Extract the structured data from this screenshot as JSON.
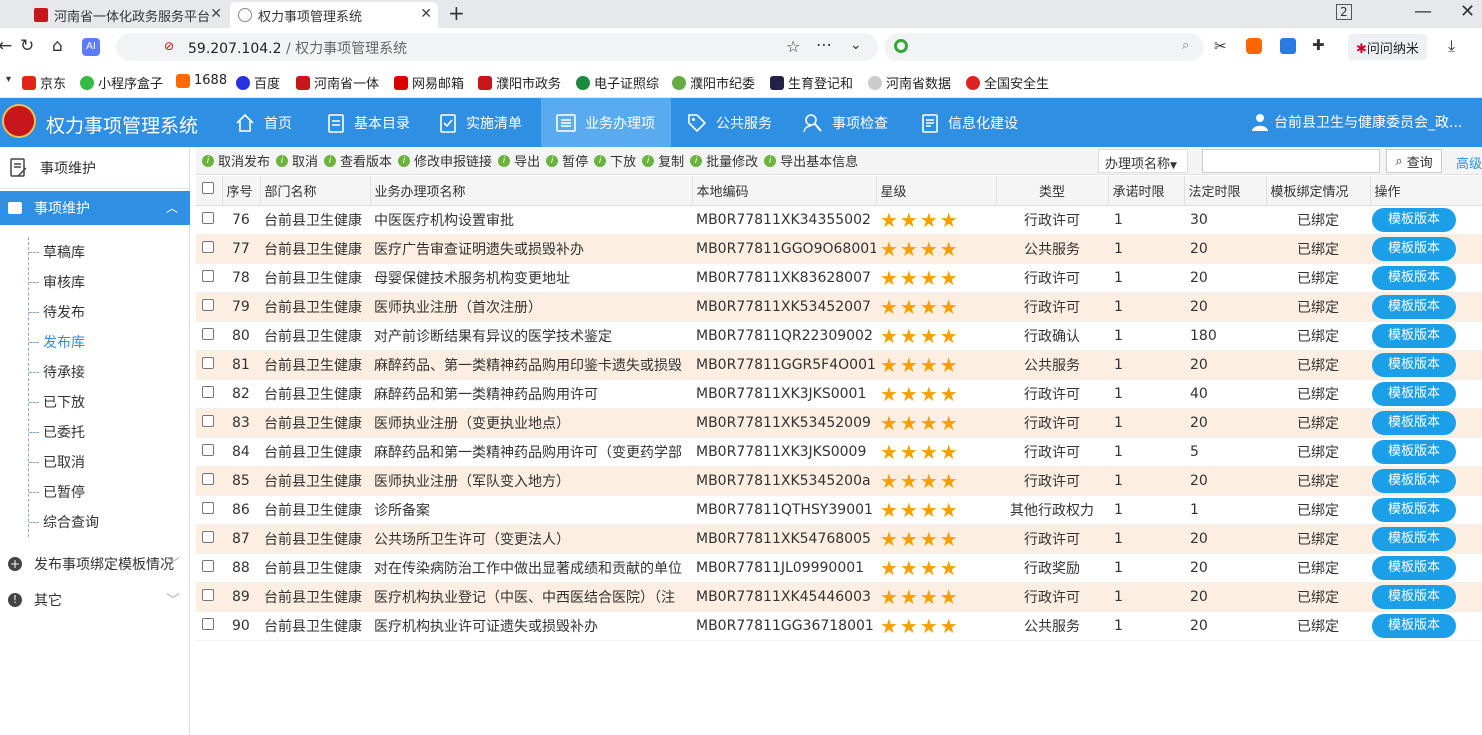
{
  "browser": {
    "tabs": [
      {
        "title": "河南省一体化政务服务平台"
      },
      {
        "title": "权力事项管理系统"
      }
    ],
    "address": {
      "host": "59.207.104.2",
      "sep": " / ",
      "page_title": "权力事项管理系统"
    },
    "search_placeholder": "",
    "user_chip": "问问纳米",
    "bookmarks": [
      "京东",
      "小程序盒子",
      "1688",
      "百度",
      "河南省一体",
      "网易邮箱",
      "濮阳市政务",
      "电子证照综",
      "濮阳市纪委",
      "生育登记和",
      "河南省数据",
      "全国安全生"
    ]
  },
  "app": {
    "title": "权力事项管理系统",
    "nav": [
      "首页",
      "基本目录",
      "实施清单",
      "业务办理项",
      "公共服务",
      "事项检查",
      "信息化建设"
    ],
    "active_nav": "业务办理项",
    "user": "台前县卫生与健康委员会_政..."
  },
  "sidebar": {
    "header": "事项维护",
    "active_group": "事项维护",
    "items": [
      "草稿库",
      "审核库",
      "待发布",
      "发布库",
      "待承接",
      "已下放",
      "已委托",
      "已取消",
      "已暂停",
      "综合查询"
    ],
    "current_item": "发布库",
    "groups": [
      "发布事项绑定模板情况",
      "其它"
    ]
  },
  "toolbar": {
    "actions": [
      "取消发布",
      "取消",
      "查看版本",
      "修改申报链接",
      "导出",
      "暂停",
      "下放",
      "复制",
      "批量修改",
      "导出基本信息"
    ],
    "select_label": "办理项名称",
    "search_value": "",
    "query_label": "查询",
    "advanced_label": "高级"
  },
  "table": {
    "headers": [
      "序号",
      "部门名称",
      "业务办理项名称",
      "本地编码",
      "星级",
      "类型",
      "承诺时限",
      "法定时限",
      "模板绑定情况",
      "操作"
    ],
    "action_label": "模板版本",
    "star_count": 4,
    "rows": [
      {
        "no": "76",
        "dept": "台前县卫生健康",
        "name": "中医医疗机构设置审批",
        "code": "MB0R77811XK34355002",
        "type": "行政许可",
        "promise": "1",
        "legal": "30",
        "bind": "已绑定"
      },
      {
        "no": "77",
        "dept": "台前县卫生健康",
        "name": "医疗广告审查证明遗失或损毁补办",
        "code": "MB0R77811GGO9O68001",
        "type": "公共服务",
        "promise": "1",
        "legal": "20",
        "bind": "已绑定"
      },
      {
        "no": "78",
        "dept": "台前县卫生健康",
        "name": "母婴保健技术服务机构变更地址",
        "code": "MB0R77811XK83628007",
        "type": "行政许可",
        "promise": "1",
        "legal": "20",
        "bind": "已绑定"
      },
      {
        "no": "79",
        "dept": "台前县卫生健康",
        "name": "医师执业注册（首次注册）",
        "code": "MB0R77811XK53452007",
        "type": "行政许可",
        "promise": "1",
        "legal": "20",
        "bind": "已绑定"
      },
      {
        "no": "80",
        "dept": "台前县卫生健康",
        "name": "对产前诊断结果有异议的医学技术鉴定",
        "code": "MB0R77811QR22309002",
        "type": "行政确认",
        "promise": "1",
        "legal": "180",
        "bind": "已绑定"
      },
      {
        "no": "81",
        "dept": "台前县卫生健康",
        "name": "麻醉药品、第一类精神药品购用印鉴卡遗失或损毁",
        "code": "MB0R77811GGR5F4O001",
        "type": "公共服务",
        "promise": "1",
        "legal": "20",
        "bind": "已绑定"
      },
      {
        "no": "82",
        "dept": "台前县卫生健康",
        "name": "麻醉药品和第一类精神药品购用许可",
        "code": "MB0R77811XK3JKS0001",
        "type": "行政许可",
        "promise": "1",
        "legal": "40",
        "bind": "已绑定"
      },
      {
        "no": "83",
        "dept": "台前县卫生健康",
        "name": "医师执业注册（变更执业地点）",
        "code": "MB0R77811XK53452009",
        "type": "行政许可",
        "promise": "1",
        "legal": "20",
        "bind": "已绑定"
      },
      {
        "no": "84",
        "dept": "台前县卫生健康",
        "name": "麻醉药品和第一类精神药品购用许可（变更药学部",
        "code": "MB0R77811XK3JKS0009",
        "type": "行政许可",
        "promise": "1",
        "legal": "5",
        "bind": "已绑定"
      },
      {
        "no": "85",
        "dept": "台前县卫生健康",
        "name": "医师执业注册（军队变入地方）",
        "code": "MB0R77811XK5345200a",
        "type": "行政许可",
        "promise": "1",
        "legal": "20",
        "bind": "已绑定"
      },
      {
        "no": "86",
        "dept": "台前县卫生健康",
        "name": "诊所备案",
        "code": "MB0R77811QTHSY39001",
        "type": "其他行政权力",
        "promise": "1",
        "legal": "1",
        "bind": "已绑定"
      },
      {
        "no": "87",
        "dept": "台前县卫生健康",
        "name": "公共场所卫生许可（变更法人）",
        "code": "MB0R77811XK54768005",
        "type": "行政许可",
        "promise": "1",
        "legal": "20",
        "bind": "已绑定"
      },
      {
        "no": "88",
        "dept": "台前县卫生健康",
        "name": "对在传染病防治工作中做出显著成绩和贡献的单位",
        "code": "MB0R77811JL09990001",
        "type": "行政奖励",
        "promise": "1",
        "legal": "20",
        "bind": "已绑定"
      },
      {
        "no": "89",
        "dept": "台前县卫生健康",
        "name": "医疗机构执业登记（中医、中西医结合医院）（注",
        "code": "MB0R77811XK45446003",
        "type": "行政许可",
        "promise": "1",
        "legal": "20",
        "bind": "已绑定"
      },
      {
        "no": "90",
        "dept": "台前县卫生健康",
        "name": "医疗机构执业许可证遗失或损毁补办",
        "code": "MB0R77811GG36718001",
        "type": "公共服务",
        "promise": "1",
        "legal": "20",
        "bind": "已绑定"
      }
    ]
  },
  "colors": {
    "primary": "#2f8fe3",
    "nav_active": "#5aaaf0",
    "row_alt": "#fcefe2",
    "star": "#f5a000",
    "button": "#1a9fe8",
    "toolbar_icon": "#6cb33e"
  }
}
